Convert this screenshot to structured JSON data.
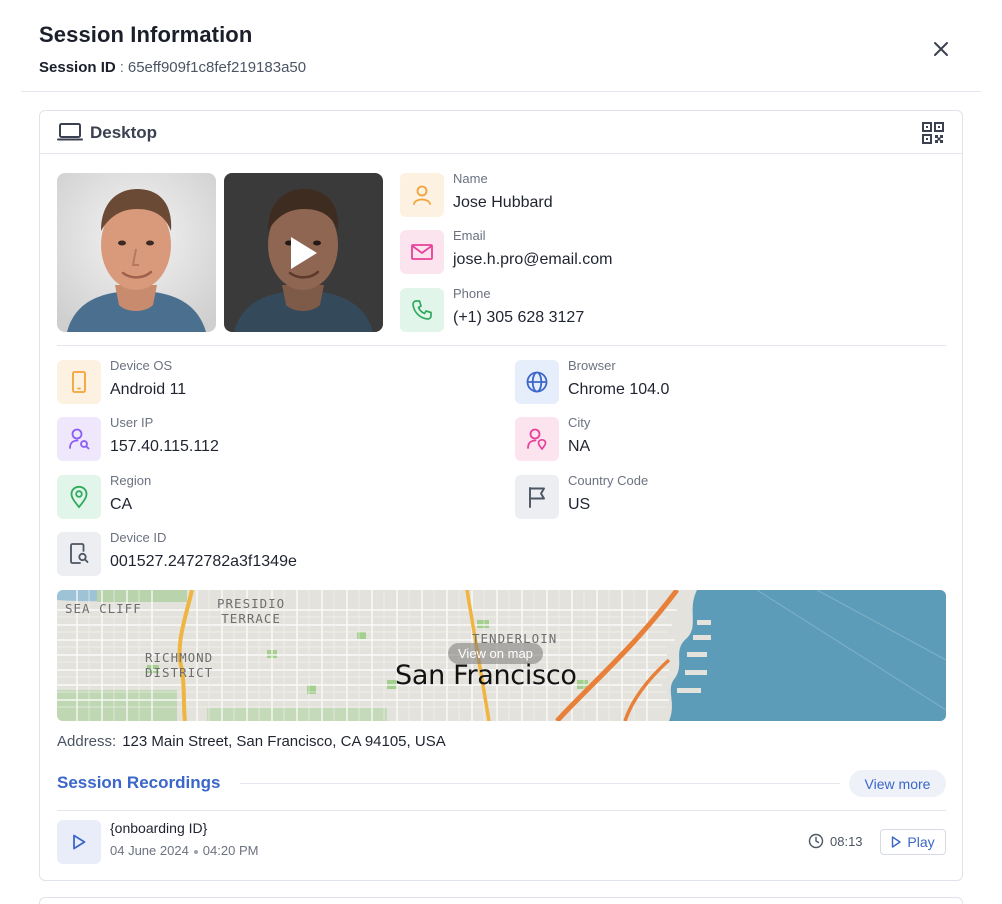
{
  "header": {
    "title": "Session Information",
    "session_id_label": "Session ID",
    "session_id_separator": ":",
    "session_id_value": "65eff909f1c8fef219183a50",
    "close_icon": "close-icon"
  },
  "card": {
    "title": "Desktop",
    "title_icon": "laptop-icon",
    "qr_icon": "qr-code-icon"
  },
  "media": {
    "photo_icon": "face-photo",
    "video_icon": "play-icon"
  },
  "contact": {
    "name_label": "Name",
    "name_value": "Jose Hubbard",
    "email_label": "Email",
    "email_value": "jose.h.pro@email.com",
    "phone_label": "Phone",
    "phone_value": "(+1) 305 628 3127"
  },
  "device": {
    "os_label": "Device OS",
    "os_value": "Android 11",
    "browser_label": "Browser",
    "browser_value": "Chrome 104.0",
    "ip_label": "User IP",
    "ip_value": "157.40.115.112",
    "city_label": "City",
    "city_value": "NA",
    "region_label": "Region",
    "region_value": "CA",
    "country_label": "Country Code",
    "country_value": "US",
    "device_id_label": "Device ID",
    "device_id_value": "001527.2472782a3f1349e"
  },
  "map": {
    "view_label": "View on map",
    "city": "San Francisco",
    "districts": {
      "sea_cliff": "SEA CLIFF",
      "presidio": "PRESIDIO\nTERRACE",
      "richmond": "RICHMOND\nDISTRICT",
      "tenderloin": "TENDERLOIN"
    }
  },
  "address": {
    "label": "Address:",
    "value": "123 Main Street, San Francisco, CA 94105, USA"
  },
  "recordings": {
    "title": "Session Recordings",
    "view_more": "View more",
    "items": [
      {
        "name": "{onboarding ID}",
        "date": "04 June 2024",
        "time": "04:20 PM",
        "duration": "08:13",
        "play_label": "Play"
      }
    ]
  },
  "colors": {
    "accent": "#3a67c9",
    "orange": "#f2a33a",
    "pink": "#e7409a",
    "green": "#2faa5c",
    "blue": "#3a67c9",
    "purple": "#8b5cf6",
    "gray": "#4b5563"
  }
}
